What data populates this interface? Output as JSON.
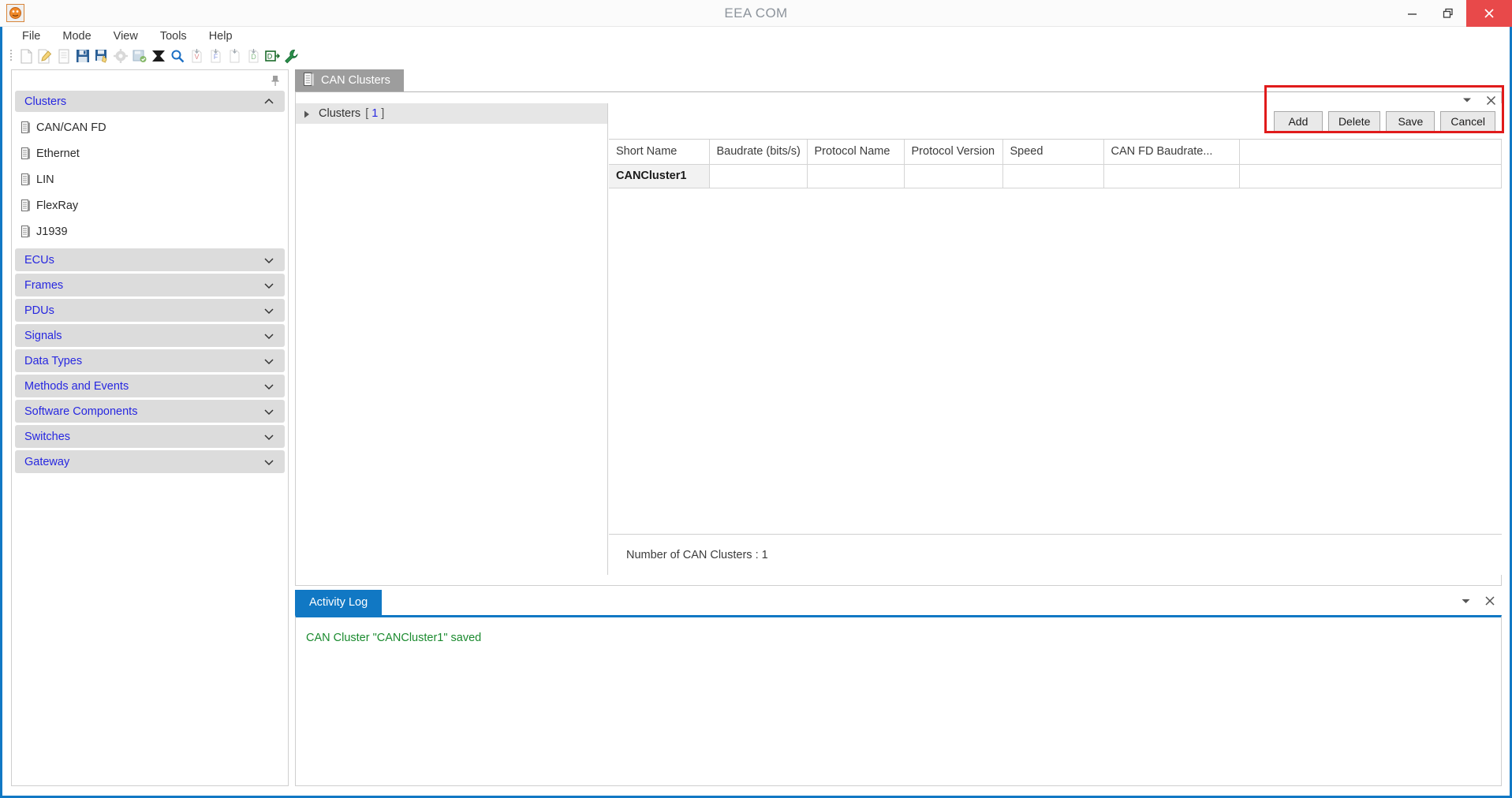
{
  "window": {
    "title": "EEA COM",
    "logo_icon": "app-logo-icon",
    "minimize_label": "─",
    "maximize_label": "❐",
    "close_label": "✕"
  },
  "menu": {
    "items": [
      {
        "label": "File"
      },
      {
        "label": "Mode"
      },
      {
        "label": "View"
      },
      {
        "label": "Tools"
      },
      {
        "label": "Help"
      }
    ]
  },
  "toolbar": {
    "buttons": [
      {
        "name": "new-file-icon",
        "tip": "New"
      },
      {
        "name": "edit-file-icon",
        "tip": "Edit"
      },
      {
        "name": "document-icon",
        "tip": "Document"
      },
      {
        "name": "save-icon",
        "tip": "Save"
      },
      {
        "name": "save-as-icon",
        "tip": "Save As"
      },
      {
        "name": "settings-gear-icon",
        "tip": "Settings"
      },
      {
        "name": "export-image-icon",
        "tip": "Export"
      },
      {
        "name": "close-cross-icon",
        "tip": "Close"
      },
      {
        "name": "search-icon",
        "tip": "Search"
      },
      {
        "name": "import-v-icon",
        "tip": "Import V"
      },
      {
        "name": "import-f-icon",
        "tip": "Import F"
      },
      {
        "name": "upload-icon",
        "tip": "Upload"
      },
      {
        "name": "import-d-icon",
        "tip": "Import D"
      },
      {
        "name": "database-export-icon",
        "tip": "Database Export"
      },
      {
        "name": "wrench-icon",
        "tip": "Tools"
      }
    ]
  },
  "sidebar": {
    "pin_icon": "pushpin-icon",
    "sections": [
      {
        "label": "Clusters",
        "expanded": true,
        "chevron": "chevron-up-icon",
        "children": [
          {
            "label": "CAN/CAN FD"
          },
          {
            "label": "Ethernet"
          },
          {
            "label": "LIN"
          },
          {
            "label": "FlexRay"
          },
          {
            "label": "J1939"
          }
        ]
      },
      {
        "label": "ECUs",
        "expanded": false,
        "chevron": "chevron-down-icon",
        "children": []
      },
      {
        "label": "Frames",
        "expanded": false,
        "chevron": "chevron-down-icon",
        "children": []
      },
      {
        "label": "PDUs",
        "expanded": false,
        "chevron": "chevron-down-icon",
        "children": []
      },
      {
        "label": "Signals",
        "expanded": false,
        "chevron": "chevron-down-icon",
        "children": []
      },
      {
        "label": "Data Types",
        "expanded": false,
        "chevron": "chevron-down-icon",
        "children": []
      },
      {
        "label": "Methods and Events",
        "expanded": false,
        "chevron": "chevron-down-icon",
        "children": []
      },
      {
        "label": "Software Components",
        "expanded": false,
        "chevron": "chevron-down-icon",
        "children": []
      },
      {
        "label": "Switches",
        "expanded": false,
        "chevron": "chevron-down-icon",
        "children": []
      },
      {
        "label": "Gateway",
        "expanded": false,
        "chevron": "chevron-down-icon",
        "children": []
      }
    ]
  },
  "main": {
    "tab": {
      "label": "CAN Clusters",
      "icon": "clusters-document-icon"
    },
    "panel_controls": [
      {
        "name": "collapse-chevron-icon",
        "glyph": "▼"
      },
      {
        "name": "close-icon",
        "glyph": "✕"
      }
    ],
    "tree": {
      "arrow_icon": "expand-arrow-icon",
      "root_label": "Clusters",
      "root_open_bracket": "[",
      "root_count": "1",
      "root_close_bracket": "]"
    },
    "buttons": [
      {
        "label": "Add",
        "name": "add-button"
      },
      {
        "label": "Delete",
        "name": "delete-button"
      },
      {
        "label": "Save",
        "name": "save-button"
      },
      {
        "label": "Cancel",
        "name": "cancel-button"
      }
    ],
    "grid": {
      "columns": [
        "Short Name",
        "Baudrate (bits/s)",
        "Protocol Name",
        "Protocol Version",
        "Speed",
        "",
        "CAN FD Baudrate...",
        ""
      ],
      "rows": [
        [
          "CANCluster1",
          "",
          "",
          "",
          "",
          "",
          "",
          ""
        ]
      ]
    },
    "status": "Number of CAN Clusters : 1"
  },
  "activity_log": {
    "tab_label": "Activity Log",
    "controls": [
      {
        "name": "collapse-chevron-icon",
        "glyph": "▼"
      },
      {
        "name": "close-icon",
        "glyph": "✕"
      }
    ],
    "messages": [
      "CAN Cluster \"CANCluster1\" saved"
    ]
  },
  "colors": {
    "accent_blue": "#1178c4",
    "tab_gray": "#9d9d9d",
    "section_gray": "#dcdcdc",
    "link_blue": "#2727e0",
    "log_green": "#1a8a2e",
    "highlight_red": "#e01b1b",
    "close_red": "#e8494a"
  }
}
